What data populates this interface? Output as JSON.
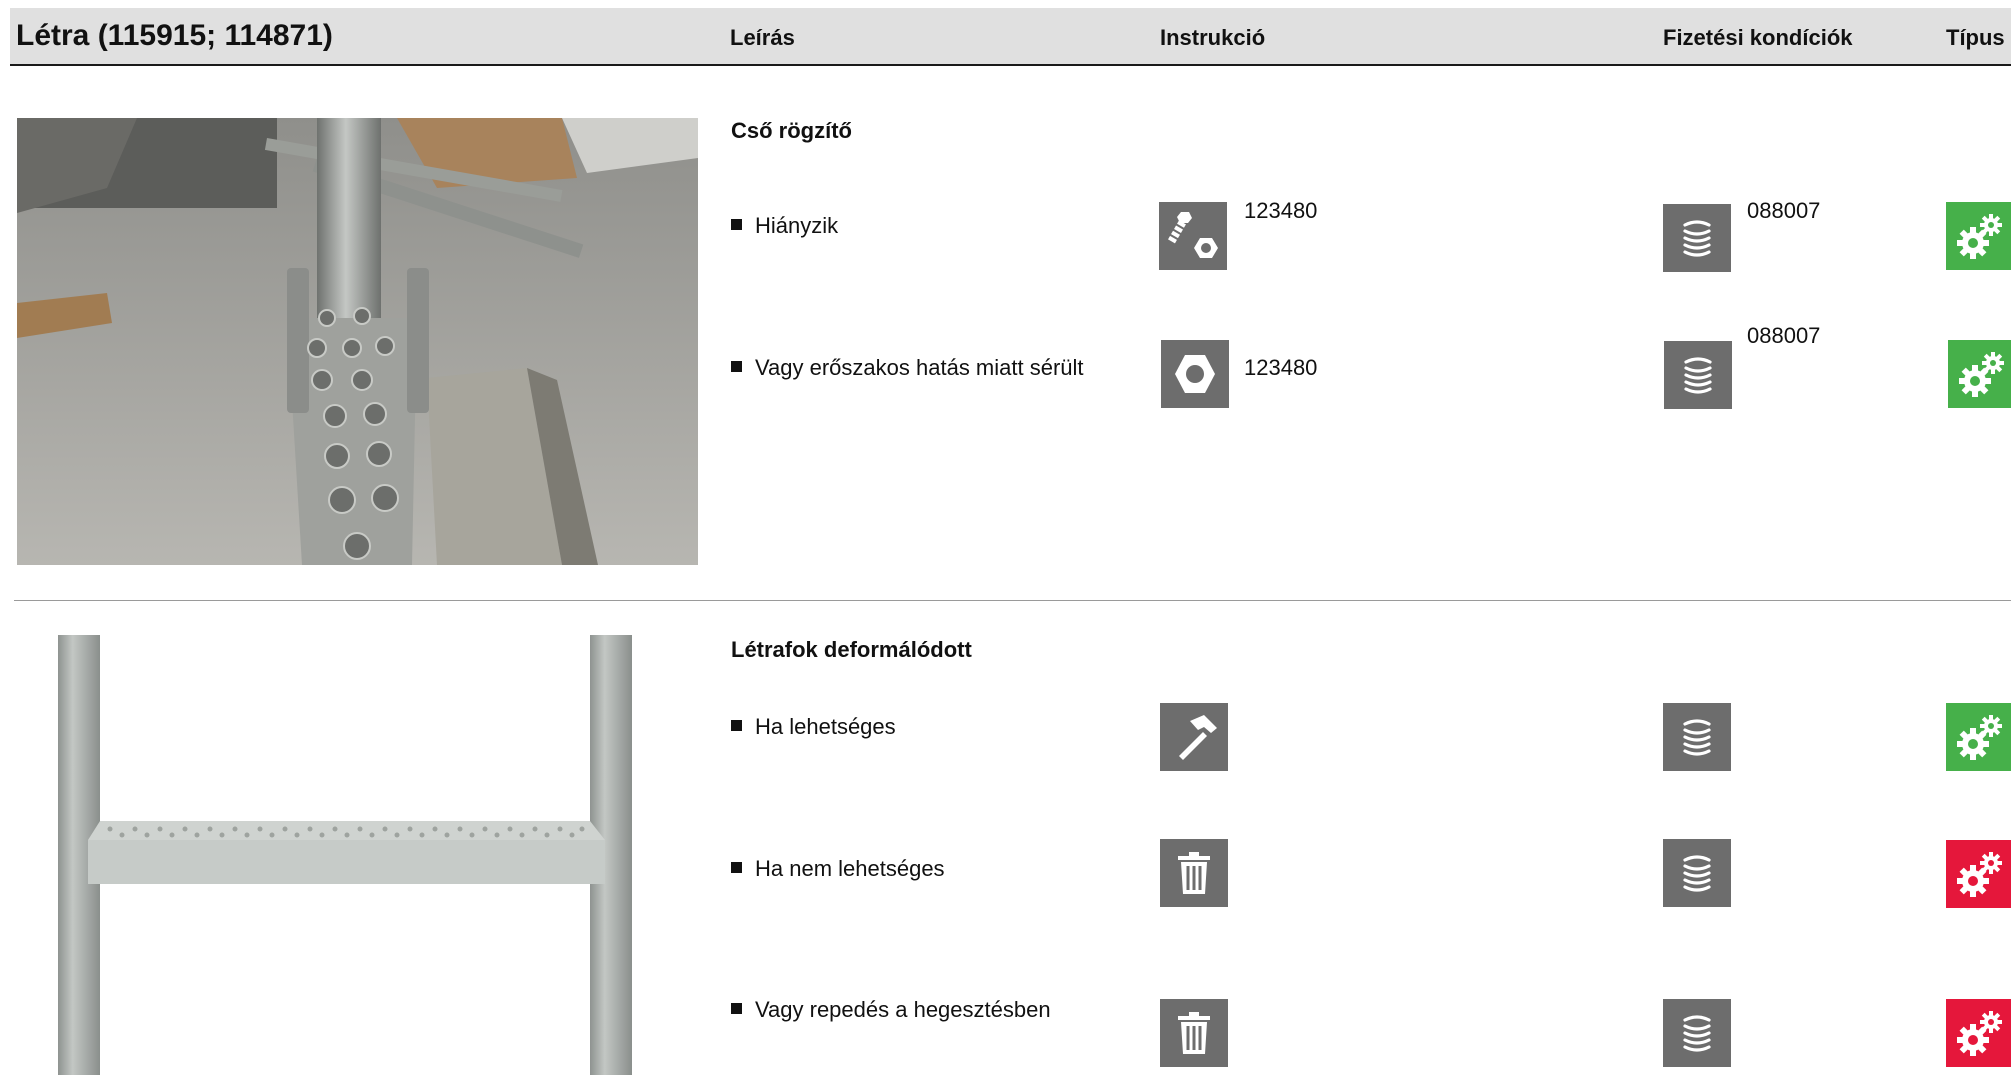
{
  "header": {
    "title": "Létra (115915; 114871)",
    "col_description": "Leírás",
    "col_instruction": "Instrukció",
    "col_payment": "Fizetési kondíciók",
    "col_type": "Típus"
  },
  "colors": {
    "header_bg": "#e0e0e0",
    "icon_gray": "#6d6d6d",
    "type_green": "#46b04a",
    "type_red": "#e5173b"
  },
  "sections": [
    {
      "title": "Cső rögzítő",
      "image": "photo-of-tube-clamp",
      "rows": [
        {
          "label": "Hiányzik",
          "instruction_icon": "bolt-nut-icon",
          "instruction_code": "123480",
          "payment_icon": "coin-stack-icon",
          "payment_code": "088007",
          "type": "green"
        },
        {
          "label": "Vagy erőszakos hatás miatt sérült",
          "instruction_icon": "nut-icon",
          "instruction_code": "123480",
          "payment_icon": "coin-stack-icon",
          "payment_code": "088007",
          "type": "green"
        }
      ]
    },
    {
      "title": "Létrafok deformálódott",
      "image": "ladder-rung-illustration",
      "rows": [
        {
          "label": "Ha lehetséges",
          "instruction_icon": "hammer-icon",
          "payment_icon": "coin-stack-icon",
          "type": "green"
        },
        {
          "label": "Ha nem lehetséges",
          "instruction_icon": "trash-icon",
          "payment_icon": "coin-stack-icon",
          "type": "red"
        },
        {
          "label": "Vagy repedés a hegesztésben",
          "instruction_icon": "trash-icon",
          "payment_icon": "coin-stack-icon",
          "type": "red"
        }
      ]
    }
  ]
}
